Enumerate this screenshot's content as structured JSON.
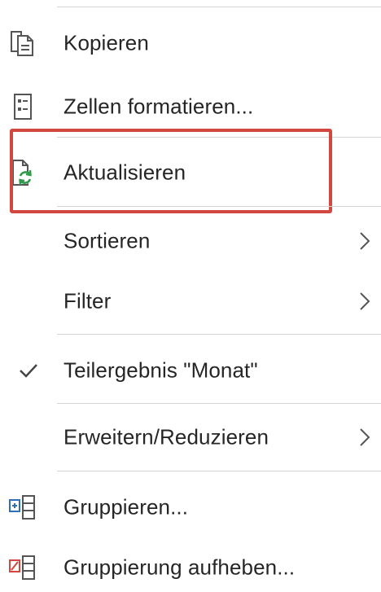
{
  "menu": {
    "items": [
      {
        "label": "Kopieren",
        "icon": "copy-icon"
      },
      {
        "label": "Zellen formatieren...",
        "icon": "format-cells-icon"
      },
      {
        "label": "Aktualisieren",
        "icon": "refresh-icon"
      },
      {
        "label": "Sortieren",
        "submenu": true
      },
      {
        "label": "Filter",
        "submenu": true
      },
      {
        "label": "Teilergebnis \"Monat\"",
        "checked": true
      },
      {
        "label": "Erweitern/Reduzieren",
        "submenu": true
      },
      {
        "label": "Gruppieren...",
        "icon": "group-icon"
      },
      {
        "label": "Gruppierung aufheben...",
        "icon": "ungroup-icon"
      }
    ]
  },
  "colors": {
    "highlight_border": "#d2473f",
    "refresh_green": "#2e9a4a",
    "group_blue": "#2f6fb5",
    "ungroup_red": "#d2473f"
  }
}
